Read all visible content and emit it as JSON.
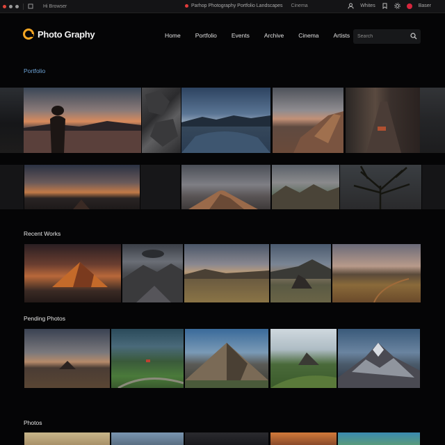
{
  "browser": {
    "tab_title": "Hi Browser",
    "url": "Parhop Photography Portfolio Landscapes",
    "url_extra": "Cinema",
    "right_label_1": "Whites",
    "right_label_2": "Baser"
  },
  "header": {
    "logo_text": "Photo Graphy",
    "nav": [
      "Home",
      "Portfolio",
      "Events",
      "Archive",
      "Cinema",
      "Artists"
    ],
    "search_placeholder": "Search"
  },
  "sections": {
    "s1": "Portfolio",
    "s2": "Recent Works",
    "s3": "Pending Photos",
    "s4": "Photos"
  },
  "colors": {
    "accent": "#f5a623",
    "section_blue": "#6fa5d8",
    "background": "#050506"
  }
}
